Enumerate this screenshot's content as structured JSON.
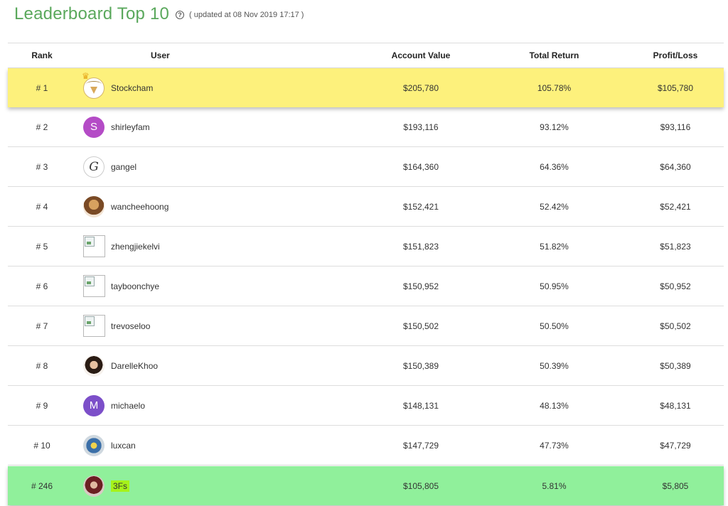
{
  "header": {
    "title": "Leaderboard Top 10",
    "help_icon": "?",
    "updated": "( updated at 08 Nov 2019 17:17 )"
  },
  "columns": {
    "rank": "Rank",
    "user": "User",
    "account_value": "Account Value",
    "total_return": "Total Return",
    "profit_loss": "Profit/Loss"
  },
  "rows": [
    {
      "rank": "# 1",
      "user": "Stockcham",
      "avatar": "stockcham-logo-with-crown",
      "account_value": "$205,780",
      "total_return": "105.78%",
      "profit_loss": "$105,780"
    },
    {
      "rank": "# 2",
      "user": "shirleyfam",
      "avatar": "letter-S",
      "avatar_letter": "S",
      "account_value": "$193,116",
      "total_return": "93.12%",
      "profit_loss": "$93,116"
    },
    {
      "rank": "# 3",
      "user": "gangel",
      "avatar": "letter-G",
      "avatar_letter": "G",
      "account_value": "$164,360",
      "total_return": "64.36%",
      "profit_loss": "$64,360"
    },
    {
      "rank": "# 4",
      "user": "wancheehoong",
      "avatar": "photo",
      "account_value": "$152,421",
      "total_return": "52.42%",
      "profit_loss": "$52,421"
    },
    {
      "rank": "# 5",
      "user": "zhengjiekelvi",
      "avatar": "broken-image",
      "account_value": "$151,823",
      "total_return": "51.82%",
      "profit_loss": "$51,823"
    },
    {
      "rank": "# 6",
      "user": "tayboonchye",
      "avatar": "broken-image",
      "account_value": "$150,952",
      "total_return": "50.95%",
      "profit_loss": "$50,952"
    },
    {
      "rank": "# 7",
      "user": "trevoseloo",
      "avatar": "broken-image",
      "account_value": "$150,502",
      "total_return": "50.50%",
      "profit_loss": "$50,502"
    },
    {
      "rank": "# 8",
      "user": "DarelleKhoo",
      "avatar": "photo",
      "account_value": "$150,389",
      "total_return": "50.39%",
      "profit_loss": "$50,389"
    },
    {
      "rank": "# 9",
      "user": "michaelo",
      "avatar": "letter-M",
      "avatar_letter": "M",
      "account_value": "$148,131",
      "total_return": "48.13%",
      "profit_loss": "$48,131"
    },
    {
      "rank": "# 10",
      "user": "luxcan",
      "avatar": "photo",
      "account_value": "$147,729",
      "total_return": "47.73%",
      "profit_loss": "$47,729"
    },
    {
      "rank": "# 246",
      "user": "3Fs",
      "avatar": "photo",
      "account_value": "$105,805",
      "total_return": "5.81%",
      "profit_loss": "$5,805"
    }
  ],
  "colors": {
    "title": "#5aa85c",
    "top_row": "#fdf17c",
    "current_user_row": "#90f09b",
    "current_user_highlight": "#a6f21a"
  }
}
